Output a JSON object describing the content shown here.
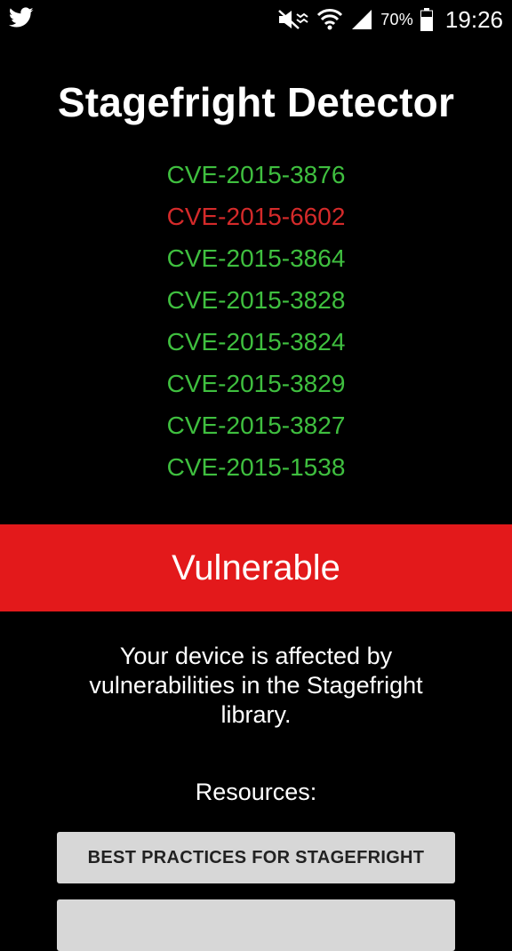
{
  "status_bar": {
    "notification_icon": "twitter-bird-icon",
    "icons": [
      "mute-icon",
      "wifi-icon",
      "signal-icon",
      "battery-icon"
    ],
    "battery_percent": "70%",
    "time": "19:26"
  },
  "app": {
    "title": "Stagefright Detector"
  },
  "cves": [
    {
      "id": "CVE-2015-3876",
      "status": "safe",
      "color": "#3fbf3f"
    },
    {
      "id": "CVE-2015-6602",
      "status": "vulnerable",
      "color": "#d42a2a"
    },
    {
      "id": "CVE-2015-3864",
      "status": "safe",
      "color": "#3fbf3f"
    },
    {
      "id": "CVE-2015-3828",
      "status": "safe",
      "color": "#3fbf3f"
    },
    {
      "id": "CVE-2015-3824",
      "status": "safe",
      "color": "#3fbf3f"
    },
    {
      "id": "CVE-2015-3829",
      "status": "safe",
      "color": "#3fbf3f"
    },
    {
      "id": "CVE-2015-3827",
      "status": "safe",
      "color": "#3fbf3f"
    },
    {
      "id": "CVE-2015-1538",
      "status": "safe",
      "color": "#3fbf3f"
    }
  ],
  "result": {
    "label": "Vulnerable",
    "color": "#e3191b",
    "description": "Your device is affected by vulnerabilities in the Stagefright library."
  },
  "resources": {
    "label": "Resources:",
    "buttons": [
      {
        "label": "BEST PRACTICES FOR STAGEFRIGHT"
      },
      {
        "label": ""
      }
    ]
  }
}
